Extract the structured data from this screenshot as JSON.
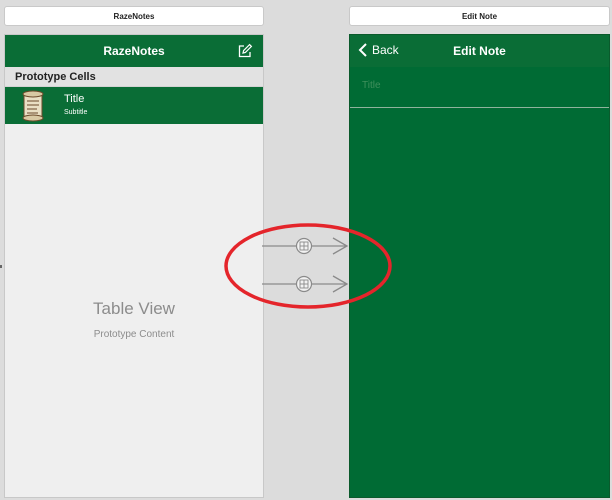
{
  "scenes": {
    "left_label": "RazeNotes",
    "right_label": "Edit Note"
  },
  "left_screen": {
    "nav_title": "RazeNotes",
    "section_header": "Prototype Cells",
    "cell": {
      "title": "Title",
      "subtitle": "Subtitle"
    },
    "table_view_label": "Table View",
    "prototype_content_label": "Prototype Content"
  },
  "right_screen": {
    "back_label": "Back",
    "nav_title": "Edit Note",
    "field_placeholder": "Title"
  },
  "icons": [
    "compose-icon",
    "scroll-icon",
    "back-chevron-icon",
    "segue-icon"
  ],
  "colors": {
    "nav_green": "#0a6d36",
    "screen_green": "#006b34",
    "annotation_red": "#e4252b",
    "canvas_gray": "#dcdcdc"
  }
}
